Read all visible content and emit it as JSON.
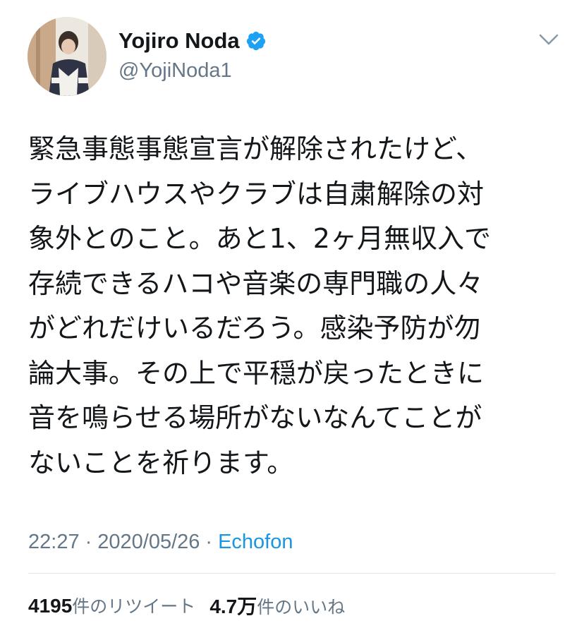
{
  "author": {
    "display_name": "Yojiro Noda",
    "handle": "@YojiNoda1",
    "verified": true,
    "avatar_icon": "profile-photo"
  },
  "tweet": {
    "text": "緊急事態事態宣言が解除されたけど、\nライブハウスやクラブは自粛解除の対\n象外とのこと。あと1、2ヶ月無収入で\n存続できるハコや音楽の専門職の人々\nがどれだけいるだろう。感染予防が勿\n論大事。その上で平穏が戻ったときに\n音を鳴らせる場所がないなんてことが\nないことを祈ります。",
    "time": "22:27",
    "separator": "·",
    "date": "2020/05/26",
    "source": "Echofon"
  },
  "stats": {
    "retweet_count": "4195",
    "retweet_label": "件のリツイート",
    "like_count": "4.7万",
    "like_label": "件のいいね"
  },
  "colors": {
    "text": "#14171a",
    "secondary": "#657786",
    "link": "#1b95e0",
    "verified": "#1da1f2",
    "divider": "#e1e8ed"
  }
}
